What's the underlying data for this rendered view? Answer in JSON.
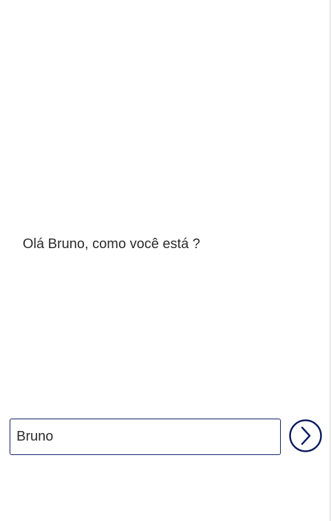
{
  "screen": {
    "greeting_text": "Olá Bruno, como você está ?",
    "name_input": {
      "value": "Bruno",
      "placeholder": ""
    },
    "next_button": {
      "icon": "chevron-right-circle-icon",
      "color": "#0b1a5e"
    }
  }
}
